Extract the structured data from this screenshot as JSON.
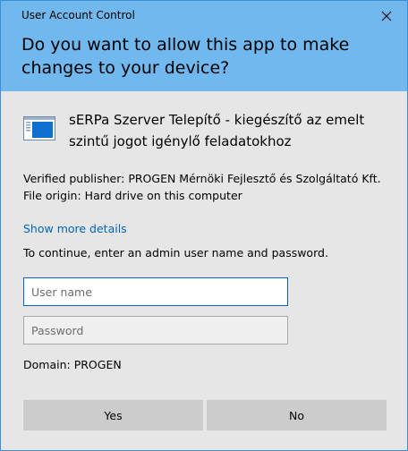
{
  "window": {
    "title": "User Account Control",
    "question": "Do you want to allow this app to make changes to your device?"
  },
  "app": {
    "icon": "installer-window-icon",
    "name": "sERPa Szerver Telepítő - kiegészítő az emelt szintű jogot igénylő feladatokhoz"
  },
  "details": {
    "publisher": "Verified publisher: PROGEN Mérnöki Fejlesztő és Szolgáltató Kft.",
    "origin": "File origin: Hard drive on this computer",
    "more_link": "Show more details"
  },
  "credentials": {
    "instruction": "To continue, enter an admin user name and password.",
    "username_placeholder": "User name",
    "username_value": "",
    "password_placeholder": "Password",
    "password_value": "",
    "domain": "Domain: PROGEN"
  },
  "buttons": {
    "yes": "Yes",
    "no": "No"
  },
  "colors": {
    "header": "#71b8ee",
    "body": "#e6e6e6",
    "link": "#0066b4",
    "focus_border": "#0a64c8",
    "button": "#cccccc"
  }
}
